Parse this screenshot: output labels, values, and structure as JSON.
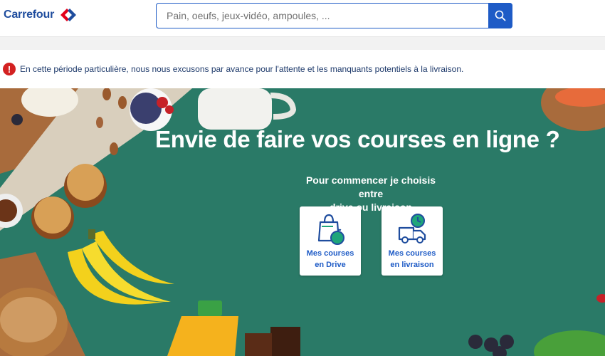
{
  "header": {
    "logo_text": "Carrefour",
    "search": {
      "value": "",
      "placeholder": "Pain, oeufs, jeux-vidéo, ampoules, ...",
      "button_icon": "search-icon"
    }
  },
  "alert": {
    "icon": "exclamation-icon",
    "text": "En cette période particulière, nous nous excusons par avance pour l'attente et les manquants potentiels à la livraison."
  },
  "hero": {
    "title": "Envie de faire vos courses en ligne ?",
    "subtitle_line1": "Pour commencer je choisis entre",
    "subtitle_line2": "drive ou livraison",
    "options": [
      {
        "line1": "Mes courses",
        "line2": "en Drive",
        "icon": "shopping-bag-icon"
      },
      {
        "line1": "Mes courses",
        "line2": "en livraison",
        "icon": "delivery-truck-icon"
      }
    ]
  },
  "colors": {
    "brand_blue": "#1e5bc6",
    "logo_red": "#e2001a",
    "hero_green": "#2a7a67",
    "alert_red": "#d32121",
    "icon_green": "#1ea57a"
  }
}
